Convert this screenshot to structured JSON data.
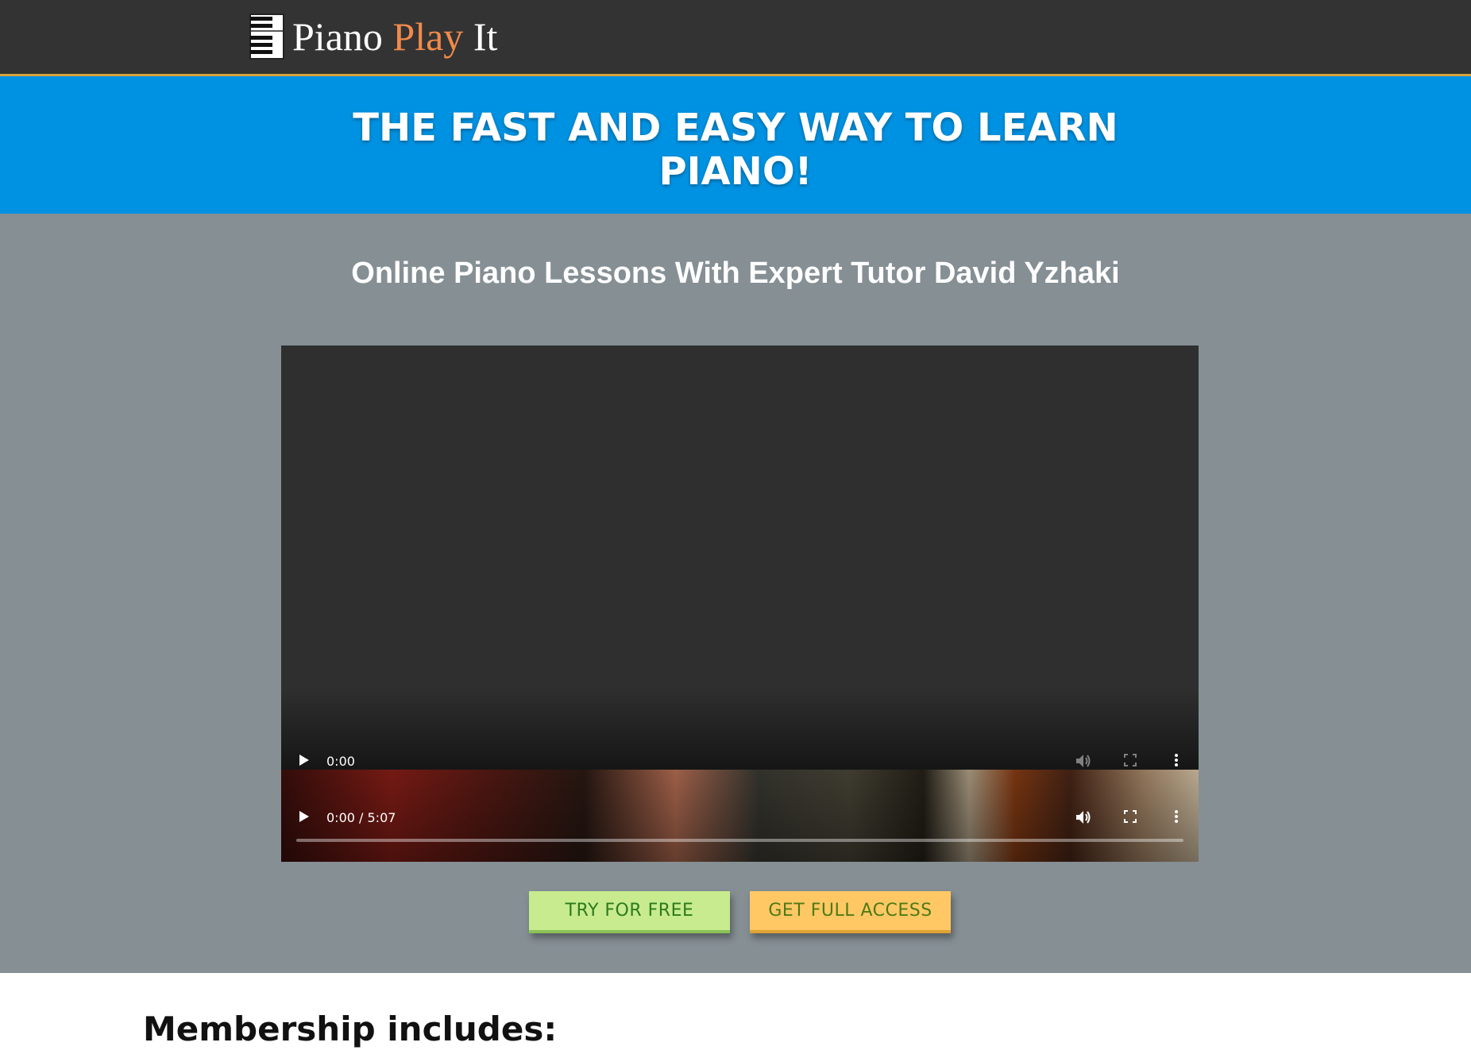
{
  "header": {
    "logo_word_1": "Piano",
    "logo_word_2": "Play",
    "logo_word_3": "It",
    "logo_icon": "piano-keys-icon",
    "colors": {
      "background": "#333333",
      "accent": "#f08a4b",
      "border": "#d8a33a"
    }
  },
  "hero": {
    "title_line_1": "THE FAST AND EASY WAY TO LEARN",
    "title_line_2": "PIANO!",
    "background": "#0092e2"
  },
  "main": {
    "subtitle": "Online Piano Lessons With Expert Tutor David Yzhaki",
    "background": "#858f94"
  },
  "video": {
    "overlay_controls": {
      "current_time": "0:00"
    },
    "controls": {
      "time_display": "0:00 / 5:07",
      "progress": 0.0
    },
    "icons": [
      "play-icon",
      "volume-icon",
      "fullscreen-icon",
      "more-options-icon"
    ]
  },
  "cta": {
    "try_free_label": "TRY FOR FREE",
    "full_access_label": "GET FULL ACCESS",
    "colors": {
      "try_free": "#c7eb8e",
      "full_access": "#ffc864"
    }
  },
  "membership": {
    "heading": "Membership includes:"
  }
}
